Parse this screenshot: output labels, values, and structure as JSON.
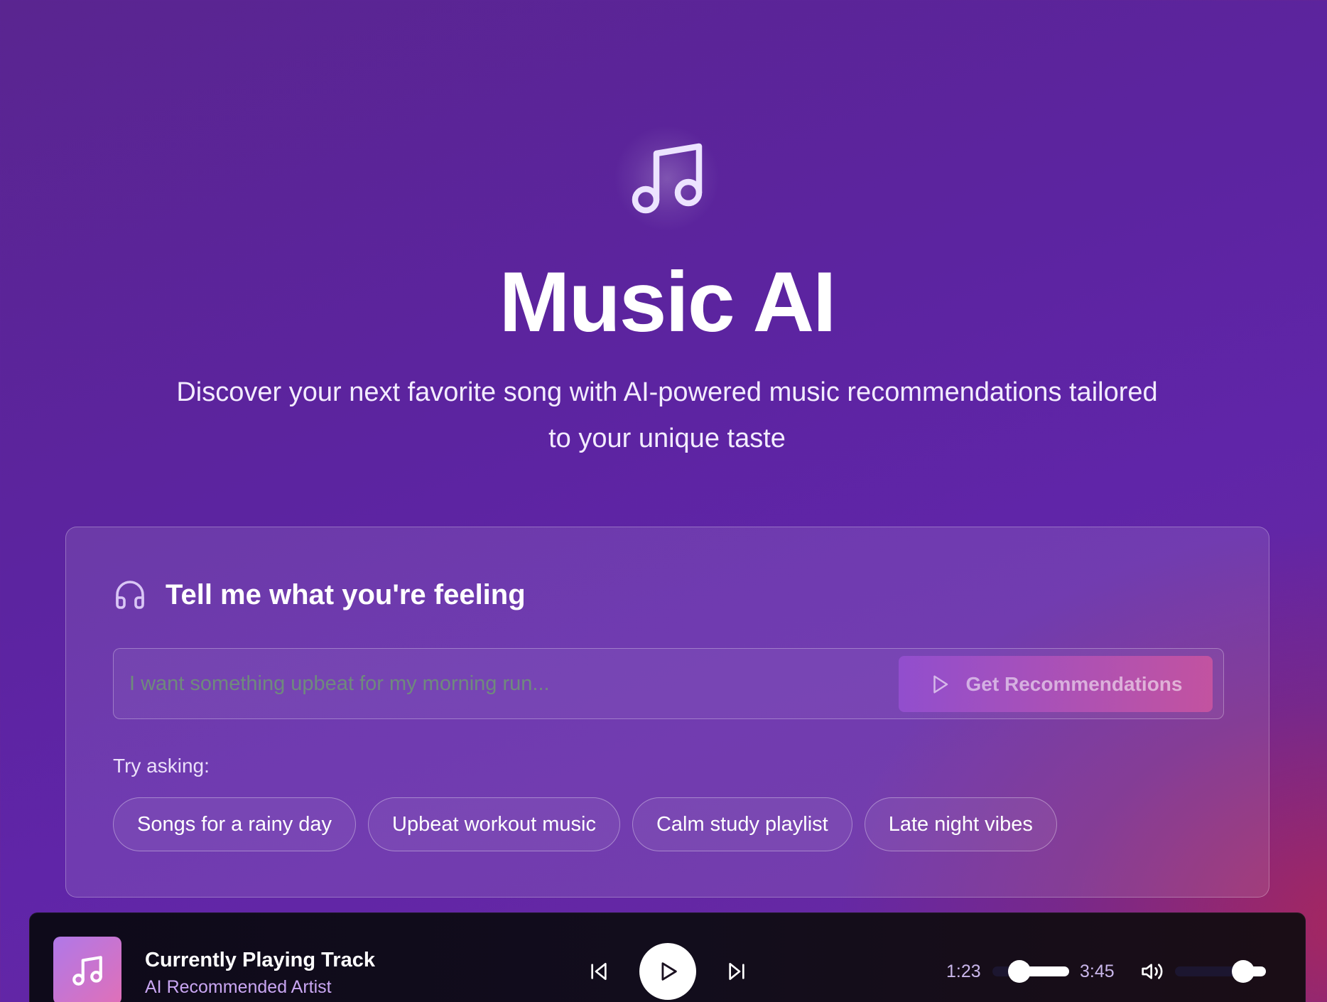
{
  "hero": {
    "icon": "music-note-icon",
    "title": "Music AI",
    "subtitle": "Discover your next favorite song with AI-powered music recommendations tailored to your unique taste"
  },
  "card": {
    "icon": "headphones-icon",
    "title": "Tell me what you're feeling",
    "input": {
      "value": "",
      "placeholder": "I want something upbeat for my morning run..."
    },
    "submit_button": {
      "icon": "play-icon",
      "label": "Get Recommendations"
    },
    "try_label": "Try asking:",
    "suggestions": [
      "Songs for a rainy day",
      "Upbeat workout music",
      "Calm study playlist",
      "Late night vibes"
    ]
  },
  "player": {
    "album_icon": "music-note-icon",
    "track_title": "Currently Playing Track",
    "artist": "AI Recommended Artist",
    "current_time": "1:23",
    "total_time": "3:45",
    "progress": 0.35,
    "volume": 0.75,
    "volume_icon": "volume-icon",
    "colors": {
      "accent_gradient_start": "#b078e8",
      "accent_gradient_end": "#e070b8",
      "artist_text": "#c9a6f2"
    }
  }
}
